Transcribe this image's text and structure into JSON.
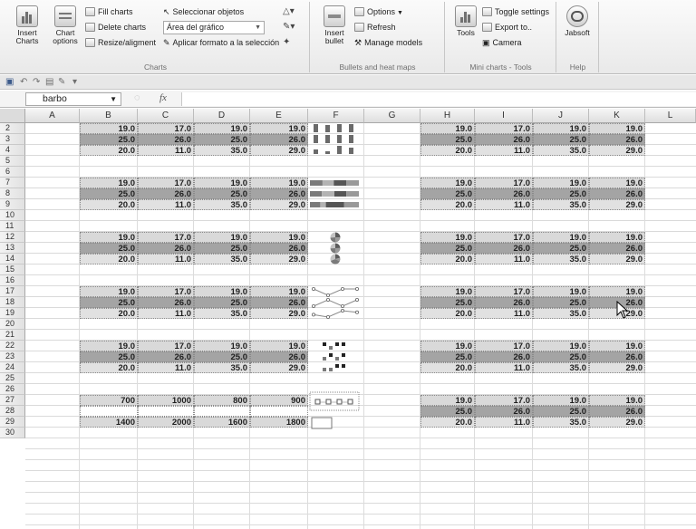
{
  "ribbon": {
    "charts_group": {
      "label": "Charts",
      "insert_charts": "Insert Charts",
      "chart_options": "Chart options",
      "fill_charts": "Fill charts",
      "delete_charts": "Delete charts",
      "resize_alignment": "Resize/aligment",
      "select_objects": "Seleccionar objetos",
      "chart_area_combo": "Área del gráfico",
      "apply_format": "Aplicar formato a la selección"
    },
    "bullets_group": {
      "label": "Bullets and heat maps",
      "insert_bullet": "Insert bullet",
      "options": "Options",
      "refresh": "Refresh",
      "manage_models": "Manage models"
    },
    "mini_group": {
      "label": "Mini charts - Tools",
      "tools": "Tools",
      "toggle_settings": "Toggle settings",
      "export_to": "Export to..",
      "camera": "Camera"
    },
    "help_group": {
      "label": "Help",
      "jabsoft": "Jabsoft"
    }
  },
  "formula_bar": {
    "name_box": "barbo",
    "fx": "fx",
    "formula": ""
  },
  "grid": {
    "columns": [
      "A",
      "B",
      "C",
      "D",
      "E",
      "F",
      "G",
      "H",
      "I",
      "J",
      "K",
      "L"
    ],
    "rows": [
      "2",
      "3",
      "4",
      "5",
      "6",
      "7",
      "8",
      "9",
      "10",
      "11",
      "12",
      "13",
      "14",
      "15",
      "16",
      "17",
      "18",
      "19",
      "20",
      "21",
      "22",
      "23",
      "24",
      "25",
      "26",
      "27",
      "28",
      "29",
      "30"
    ],
    "blocks": [
      {
        "rows": [
          [
            "19.0",
            "17.0",
            "19.0",
            "19.0"
          ],
          [
            "25.0",
            "26.0",
            "25.0",
            "26.0"
          ],
          [
            "20.0",
            "11.0",
            "35.0",
            "29.0"
          ]
        ]
      },
      {
        "rows": [
          [
            "19.0",
            "17.0",
            "19.0",
            "19.0"
          ],
          [
            "25.0",
            "26.0",
            "25.0",
            "26.0"
          ],
          [
            "20.0",
            "11.0",
            "35.0",
            "29.0"
          ]
        ]
      },
      {
        "rows": [
          [
            "19.0",
            "17.0",
            "19.0",
            "19.0"
          ],
          [
            "25.0",
            "26.0",
            "25.0",
            "26.0"
          ],
          [
            "20.0",
            "11.0",
            "35.0",
            "29.0"
          ]
        ]
      },
      {
        "rows": [
          [
            "19.0",
            "17.0",
            "19.0",
            "19.0"
          ],
          [
            "25.0",
            "26.0",
            "25.0",
            "26.0"
          ],
          [
            "20.0",
            "11.0",
            "35.0",
            "29.0"
          ]
        ]
      },
      {
        "rows": [
          [
            "19.0",
            "17.0",
            "19.0",
            "19.0"
          ],
          [
            "25.0",
            "26.0",
            "25.0",
            "26.0"
          ],
          [
            "20.0",
            "11.0",
            "35.0",
            "29.0"
          ]
        ]
      },
      {
        "rows": [
          [
            "700",
            "1000",
            "800",
            "900"
          ],
          [
            "",
            "",
            "",
            ""
          ],
          [
            "1400",
            "2000",
            "1600",
            "1800"
          ]
        ]
      }
    ],
    "right_blocks": [
      {
        "rows": [
          [
            "19.0",
            "17.0",
            "19.0",
            "19.0"
          ],
          [
            "25.0",
            "26.0",
            "25.0",
            "26.0"
          ],
          [
            "20.0",
            "11.0",
            "35.0",
            "29.0"
          ]
        ]
      },
      {
        "rows": [
          [
            "19.0",
            "17.0",
            "19.0",
            "19.0"
          ],
          [
            "25.0",
            "26.0",
            "25.0",
            "26.0"
          ],
          [
            "20.0",
            "11.0",
            "35.0",
            "29.0"
          ]
        ]
      },
      {
        "rows": [
          [
            "19.0",
            "17.0",
            "19.0",
            "19.0"
          ],
          [
            "25.0",
            "26.0",
            "25.0",
            "26.0"
          ],
          [
            "20.0",
            "11.0",
            "35.0",
            "29.0"
          ]
        ]
      },
      {
        "rows": [
          [
            "19.0",
            "17.0",
            "19.0",
            "19.0"
          ],
          [
            "25.0",
            "26.0",
            "25.0",
            "26.0"
          ],
          [
            "20.0",
            "11.0",
            "35.0",
            "29.0"
          ]
        ]
      },
      {
        "rows": [
          [
            "19.0",
            "17.0",
            "19.0",
            "19.0"
          ],
          [
            "25.0",
            "26.0",
            "25.0",
            "26.0"
          ],
          [
            "20.0",
            "11.0",
            "35.0",
            "29.0"
          ]
        ]
      },
      {
        "rows": [
          [
            "19.0",
            "17.0",
            "19.0",
            "19.0"
          ],
          [
            "25.0",
            "26.0",
            "25.0",
            "26.0"
          ],
          [
            "20.0",
            "11.0",
            "35.0",
            "29.0"
          ]
        ]
      }
    ],
    "mini_charts": [
      "bar-sparkline",
      "stacked-bar-sparkline",
      "pie-sparkline",
      "line-sparkline",
      "win-loss-sparkline",
      "bullet-sparkline"
    ]
  },
  "colors": {
    "shade_light": "#d9d9d9",
    "shade_dark": "#a4a4a4",
    "mini_bar": "#6a6a6a"
  }
}
